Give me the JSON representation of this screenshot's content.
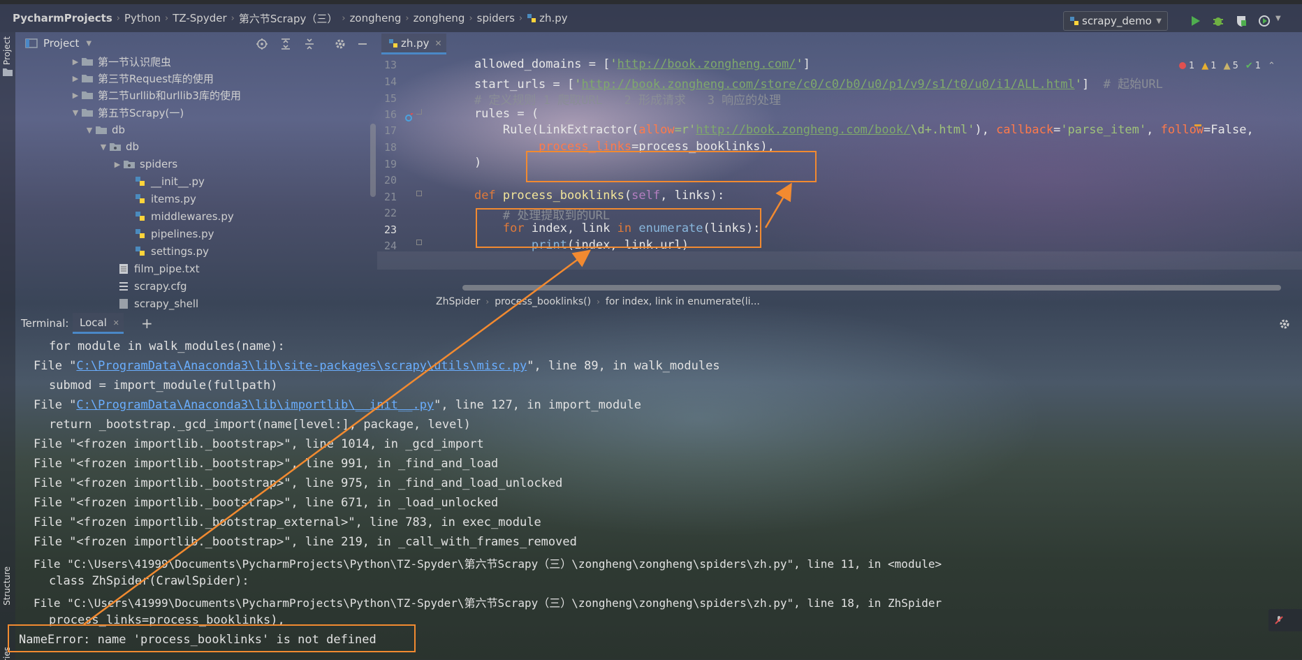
{
  "nav": {
    "crumbs": [
      "PycharmProjects",
      "Python",
      "TZ-Spyder",
      "第六节Scrapy（三）",
      "zongheng",
      "zongheng",
      "spiders",
      "zh.py"
    ],
    "run_config": "scrapy_demo"
  },
  "project_panel": {
    "title": "Project",
    "tree": [
      {
        "label": "第一节认识爬虫",
        "type": "folder",
        "expanded": false
      },
      {
        "label": "第三节Request库的使用",
        "type": "folder",
        "expanded": false
      },
      {
        "label": "第二节urllib和urllib3库的使用",
        "type": "folder",
        "expanded": false
      },
      {
        "label": "第五节Scrapy(一)",
        "type": "folder",
        "expanded": true
      },
      {
        "label": "db",
        "type": "folder",
        "expanded": true
      },
      {
        "label": "db",
        "type": "package",
        "expanded": true
      },
      {
        "label": "spiders",
        "type": "package",
        "expanded": false
      },
      {
        "label": "__init__.py",
        "type": "python"
      },
      {
        "label": "items.py",
        "type": "python"
      },
      {
        "label": "middlewares.py",
        "type": "python"
      },
      {
        "label": "pipelines.py",
        "type": "python"
      },
      {
        "label": "settings.py",
        "type": "python"
      },
      {
        "label": "film_pipe.txt",
        "type": "text"
      },
      {
        "label": "scrapy.cfg",
        "type": "config"
      },
      {
        "label": "scrapy_shell",
        "type": "file"
      }
    ]
  },
  "editor": {
    "tab": "zh.py",
    "line_numbers": [
      "13",
      "14",
      "15",
      "16",
      "17",
      "18",
      "19",
      "20",
      "21",
      "22",
      "23",
      "24"
    ],
    "inspections": {
      "errors": "1",
      "warnings": "1",
      "weak_warnings": "5",
      "ok": "1"
    },
    "code": {
      "l13": {
        "a": "    allowed_domains = [",
        "b": "'",
        "c": "http://book.zongheng.com/",
        "d": "'",
        "e": "]"
      },
      "l14": {
        "a": "    start_urls = [",
        "b": "'",
        "c": "http://book.zongheng.com/store/c0/c0/b0/u0/p1/v9/s1/t0/u0/i1/ALL.html",
        "d": "'",
        "e": "]  ",
        "f": "# 起始URL"
      },
      "l15": {
        "a": "    # 定义规则 1 爬取URL   2 形成请求   3 响应的处理"
      },
      "l16": {
        "a": "    rules = ("
      },
      "l17": {
        "a": "        Rule(",
        "b": "LinkExtractor",
        "c": "(",
        "d": "allow",
        "e": "=r'",
        "f": "http://book.zongheng.com/book/",
        "g": "\\d+.html'",
        "h": "), ",
        "i": "callback",
        "j": "=",
        "k": "'parse_item'",
        "l": ", ",
        "m": "follow",
        "n": "=False,"
      },
      "l18": {
        "a": "             ",
        "b": "process_links",
        "c": "=process_booklinks),"
      },
      "l19": {
        "a": "    )"
      },
      "l20": {
        "a": ""
      },
      "l21": {
        "a": "    ",
        "b": "def",
        "c": " ",
        "d": "process_booklinks",
        "e": "(",
        "f": "self",
        "g": ", links):"
      },
      "l22": {
        "a": "        # 处理提取到的URL"
      },
      "l23": {
        "a": "        ",
        "b": "for",
        "c": " index, link ",
        "d": "in",
        "e": " ",
        "f": "enumerate",
        "g": "(links):"
      },
      "l24": {
        "a": "            ",
        "b": "print",
        "c": "(index, link.url)"
      }
    },
    "breadcrumb": [
      "ZhSpider",
      "process_booklinks()",
      "for index, link in enumerate(li..."
    ]
  },
  "terminal": {
    "tabs": [
      "Terminal:",
      "Local"
    ],
    "lines": [
      {
        "indent": 2,
        "text": "for module in walk_modules(name):"
      },
      {
        "indent": 1,
        "pre": "File \"",
        "link": "C:\\ProgramData\\Anaconda3\\lib\\site-packages\\scrapy\\utils\\misc.py",
        "post": "\", line 89, in walk_modules"
      },
      {
        "indent": 2,
        "text": "submod = import_module(fullpath)"
      },
      {
        "indent": 1,
        "pre": "File \"",
        "link": "C:\\ProgramData\\Anaconda3\\lib\\importlib\\__init__.py",
        "post": "\", line 127, in import_module"
      },
      {
        "indent": 2,
        "text": "return _bootstrap._gcd_import(name[level:], package, level)"
      },
      {
        "indent": 1,
        "text": "File \"<frozen importlib._bootstrap>\", line 1014, in _gcd_import"
      },
      {
        "indent": 1,
        "text": "File \"<frozen importlib._bootstrap>\", line 991, in _find_and_load"
      },
      {
        "indent": 1,
        "text": "File \"<frozen importlib._bootstrap>\", line 975, in _find_and_load_unlocked"
      },
      {
        "indent": 1,
        "text": "File \"<frozen importlib._bootstrap>\", line 671, in _load_unlocked"
      },
      {
        "indent": 1,
        "text": "File \"<frozen importlib._bootstrap_external>\", line 783, in exec_module"
      },
      {
        "indent": 1,
        "text": "File \"<frozen importlib._bootstrap>\", line 219, in _call_with_frames_removed"
      },
      {
        "indent": 1,
        "text": "File \"C:\\Users\\41999\\Documents\\PycharmProjects\\Python\\TZ-Spyder\\第六节Scrapy（三）\\zongheng\\zongheng\\spiders\\zh.py\", line 11, in <module>"
      },
      {
        "indent": 2,
        "text": "class ZhSpider(CrawlSpider):"
      },
      {
        "indent": 1,
        "text": "File \"C:\\Users\\41999\\Documents\\PycharmProjects\\Python\\TZ-Spyder\\第六节Scrapy（三）\\zongheng\\zongheng\\spiders\\zh.py\", line 18, in ZhSpider"
      },
      {
        "indent": 2,
        "text": "process_links=process_booklinks),"
      },
      {
        "indent": 0,
        "text": "NameError: name 'process_booklinks' is not defined"
      }
    ]
  },
  "side_labels": {
    "project": "Project",
    "structure": "Structure",
    "favorites": "ries"
  },
  "colors": {
    "annotation": "#f28a30",
    "accent": "#4a88c7",
    "link": "#6aaeff"
  }
}
